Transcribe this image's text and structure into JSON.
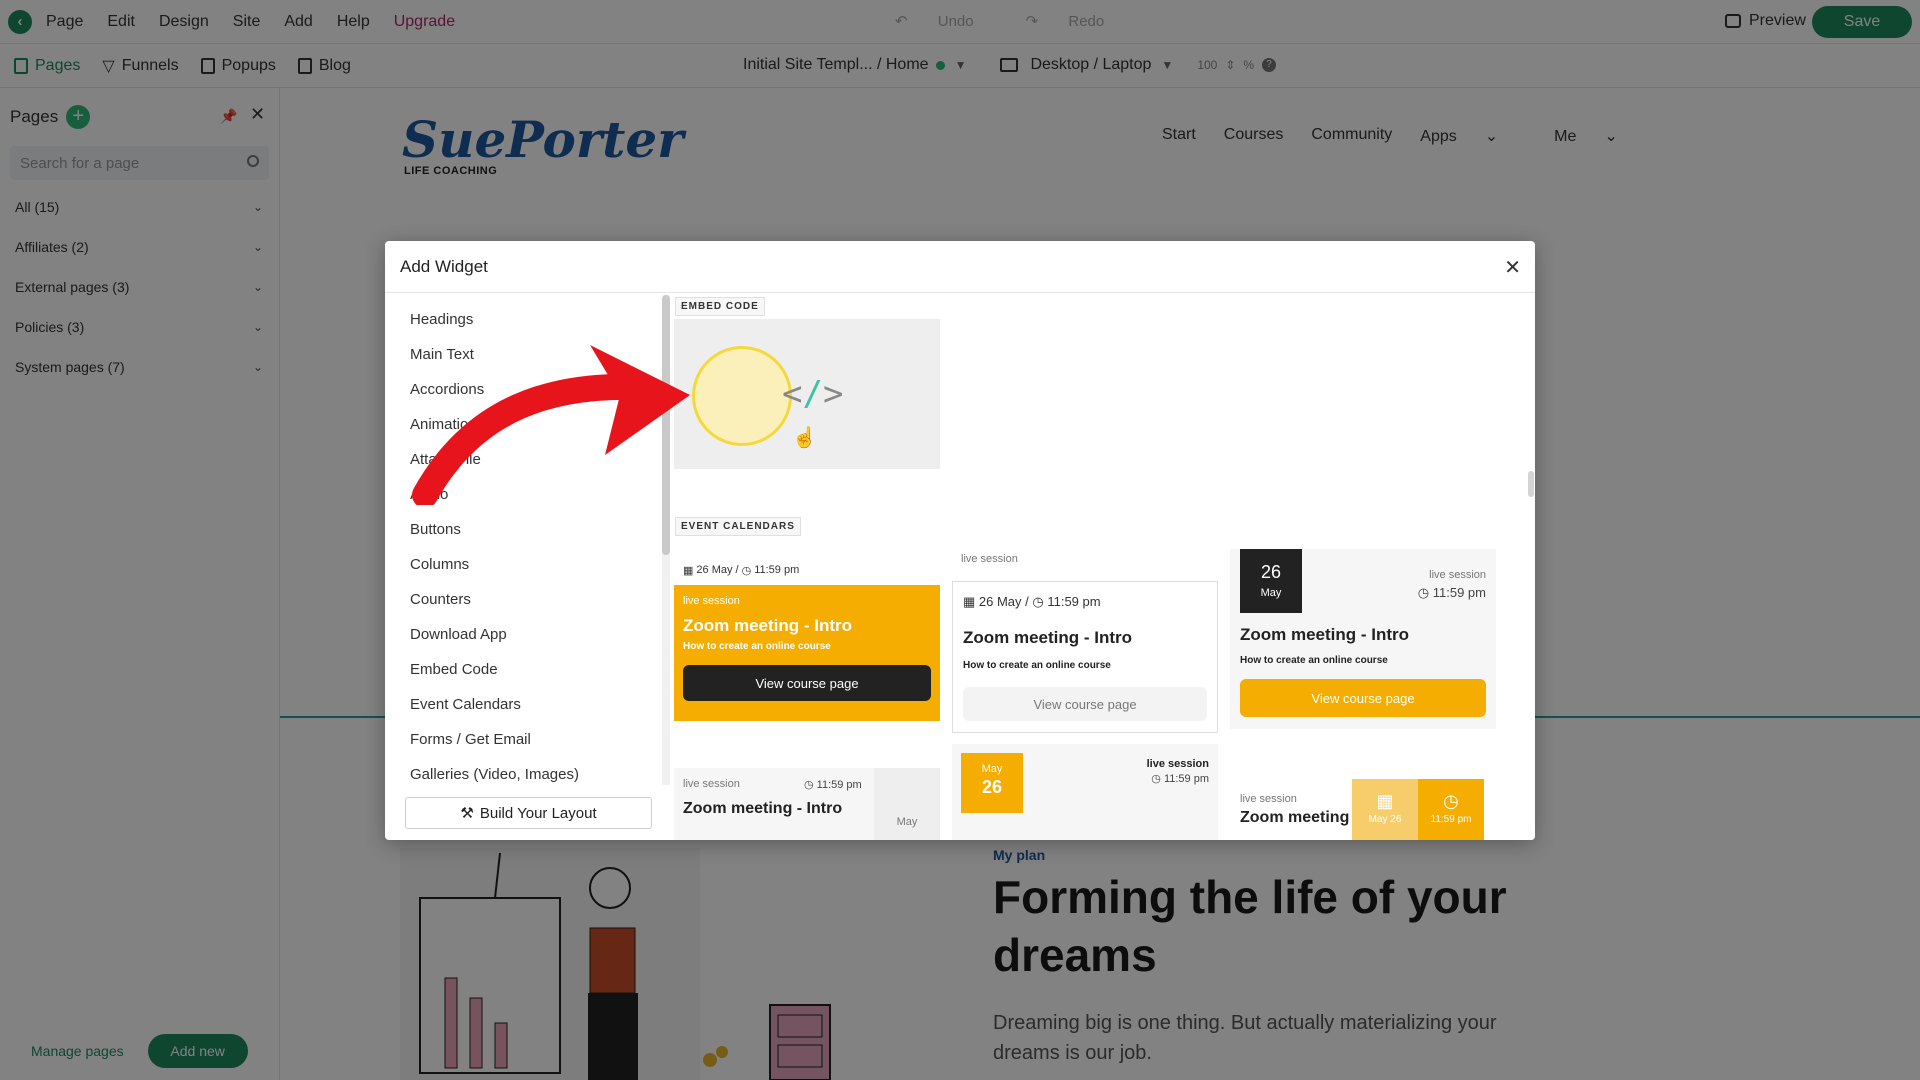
{
  "menubar": {
    "items": [
      "Page",
      "Edit",
      "Design",
      "Site",
      "Add",
      "Help"
    ],
    "upgrade": "Upgrade",
    "undo": "Undo",
    "redo": "Redo",
    "preview": "Preview",
    "save": "Save"
  },
  "toolbar": {
    "tabs": [
      "Pages",
      "Funnels",
      "Popups",
      "Blog"
    ],
    "template": "Initial Site Templ... / Home",
    "device": "Desktop / Laptop",
    "zoom": "100",
    "zoom_unit": "%",
    "help": "?"
  },
  "sidebar": {
    "title": "Pages",
    "search_placeholder": "Search for a page",
    "groups": [
      "All (15)",
      "Affiliates (2)",
      "External pages (3)",
      "Policies (3)",
      "System pages (7)"
    ],
    "manage": "Manage pages",
    "add_new": "Add new"
  },
  "site": {
    "brand": "SuePorter",
    "brand_sub": "LIFE COACHING",
    "nav": [
      "Start",
      "Courses",
      "Community",
      "Apps",
      "Me"
    ],
    "plan_label": "My plan",
    "hero_title": "Forming the life of your dreams",
    "hero_text": "Dreaming big is one thing. But actually materializing your dreams is our job."
  },
  "modal": {
    "title": "Add Widget",
    "widgets": [
      "Headings",
      "Main Text",
      "Accordions",
      "Animations",
      "Attach File",
      "Audio",
      "Buttons",
      "Columns",
      "Counters",
      "Download App",
      "Embed Code",
      "Event Calendars",
      "Forms / Get Email",
      "Galleries (Video, Images)"
    ],
    "build_layout": "Build Your Layout",
    "section_embed": "EMBED CODE",
    "section_calendars": "EVENT CALENDARS",
    "cal": {
      "date_time": "26 May / ",
      "time": "11:59 pm",
      "live": "live session",
      "title": "Zoom meeting - Intro",
      "title_short": "Zoom meeting",
      "subtitle": "How to create an online course",
      "button": "View course page",
      "day": "26",
      "month": "May",
      "mini_date": "May 26"
    }
  },
  "colors": {
    "brand_green": "#1d8a5f",
    "accent_yellow": "#f4ad00",
    "brand_blue": "#1e56a0",
    "arrow_red": "#e8141c"
  }
}
